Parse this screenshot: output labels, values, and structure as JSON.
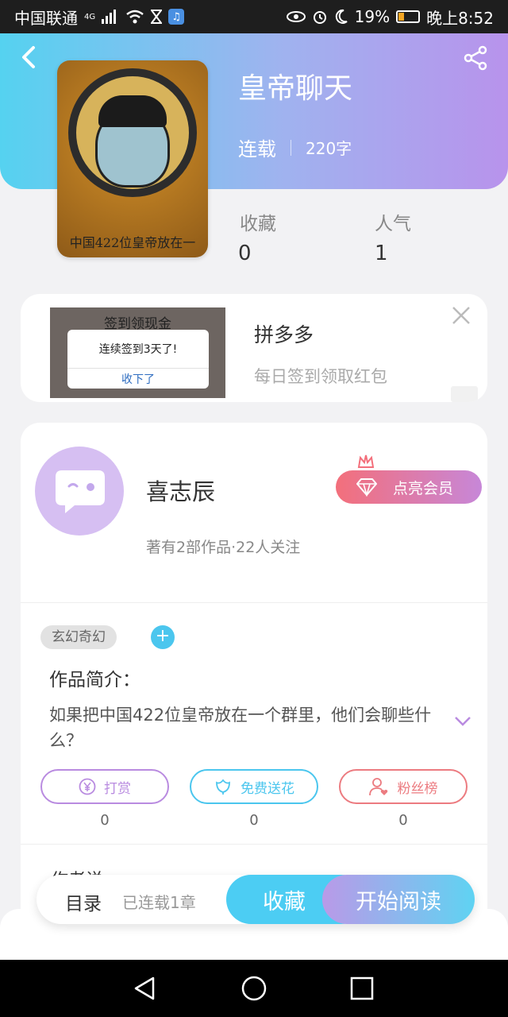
{
  "status_bar": {
    "carrier": "中国联通",
    "network": "4G",
    "battery": "19%",
    "time": "晚上8:52",
    "music_icon": "music-app-icon"
  },
  "header": {
    "back_icon": "back-arrow-icon",
    "share_icon": "share-icon",
    "title": "皇帝聊天",
    "status": "连载",
    "word_count": "220字",
    "cover_caption": "中国422位皇帝放在一"
  },
  "stats": {
    "favorites_label": "收藏",
    "favorites_value": "0",
    "popularity_label": "人气",
    "popularity_value": "1"
  },
  "ad": {
    "image_title": "签到领现金",
    "image_message": "连续签到3天了!",
    "image_button": "收下了",
    "name": "拼多多",
    "description": "每日签到领取红包"
  },
  "author": {
    "name": "喜志辰",
    "meta": "著有2部作品·22人关注",
    "vip_label": "点亮会员"
  },
  "book": {
    "genre": "玄幻奇幻",
    "intro_label": "作品简介：",
    "intro_text": "如果把中国422位皇帝放在一个群里，他们会聊些什么？",
    "author_says_label": "作者说"
  },
  "actions": [
    {
      "label": "打赏",
      "value": "0",
      "color": "#b98be0"
    },
    {
      "label": "免费送花",
      "value": "0",
      "color": "#4bc6ee"
    },
    {
      "label": "粉丝榜",
      "value": "0",
      "color": "#ec7b80"
    }
  ],
  "bottom_bar": {
    "toc": "目录",
    "serial": "已连载1章",
    "collect": "收藏",
    "read": "开始阅读"
  },
  "colors": {
    "header_start": "#55d2f0",
    "header_end": "#b893ec",
    "accent_blue": "#4ccdf3",
    "vip_start": "#f36f7b"
  }
}
